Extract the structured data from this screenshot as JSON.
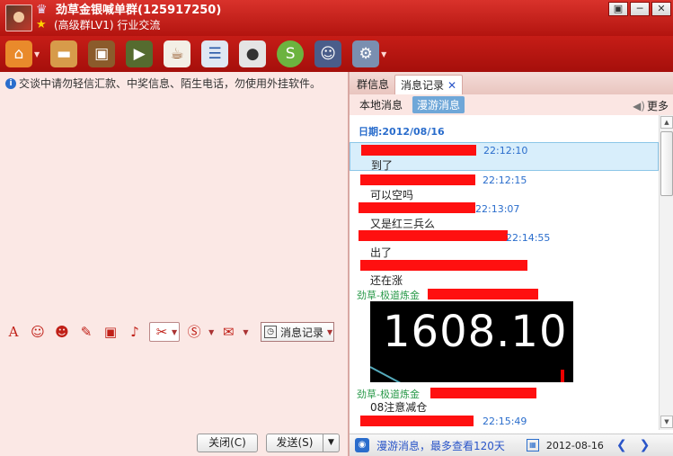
{
  "window": {
    "title": "劲草金银喊单群(125917250)",
    "subtitle": "(高级群LV1) 行业交流",
    "controls": [
      "▣",
      "─",
      "✕"
    ]
  },
  "toolbar": {
    "icons": [
      "home-icon",
      "folder-icon",
      "album-icon",
      "video-icon",
      "coffee-icon",
      "notice-icon",
      "mic-icon",
      "s-icon",
      "agent-icon",
      "gear-icon"
    ]
  },
  "notice": {
    "text": "交谈中请勿轻信汇款、中奖信息、陌生电话，勿使用外挂软件。"
  },
  "format_bar": {
    "history_label": "消息记录"
  },
  "buttons": {
    "close": "关闭(C)",
    "send": "发送(S)"
  },
  "right_tabs": [
    "群信息",
    "消息记录"
  ],
  "sub_tabs": [
    "本地消息",
    "漫游消息"
  ],
  "more_label": "更多",
  "history": {
    "date": "日期:2012/08/16",
    "messages": [
      {
        "time": "22:12:10",
        "text": "到了"
      },
      {
        "time": "22:12:15",
        "text": "可以空吗"
      },
      {
        "time": "22:13:07",
        "text": "又是红三兵么"
      },
      {
        "time": "22:14:55",
        "text": "出了"
      },
      {
        "time": "",
        "text": "还在涨"
      },
      {
        "sender": "劲草-极道炼金",
        "time": "",
        "text": "",
        "image_value": "1608.10"
      },
      {
        "sender": "劲草-极道炼金",
        "time": "",
        "text": "08注意减仓"
      },
      {
        "time": "22:15:49",
        "text": ""
      }
    ]
  },
  "bottom": {
    "roam_text": "漫游消息，最多查看120天",
    "date": "2012-08-16"
  }
}
